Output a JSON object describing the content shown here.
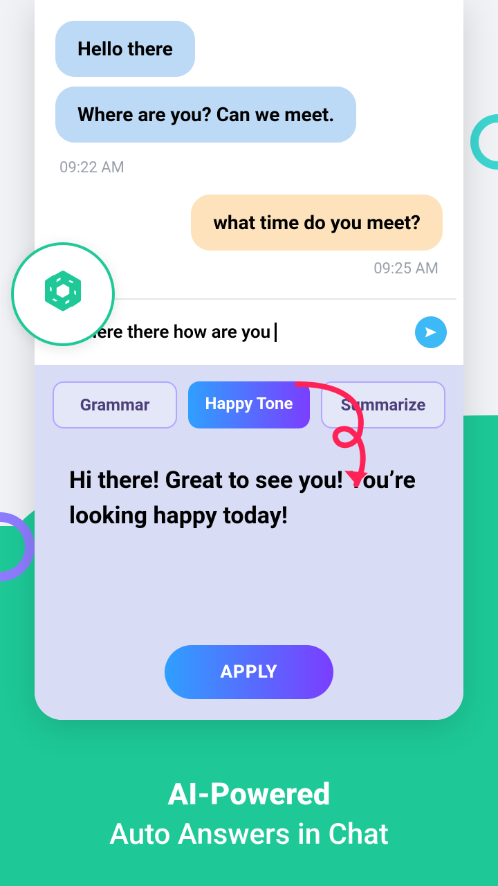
{
  "chat": {
    "messages": [
      {
        "text": "Hello there",
        "side": "left"
      },
      {
        "text": "Where are you? Can we meet.",
        "side": "left"
      }
    ],
    "time_left": "09:22 AM",
    "reply": {
      "text": "what time do you meet?"
    },
    "time_right": "09:25 AM"
  },
  "input": {
    "text": "Here there how are you"
  },
  "panel": {
    "pills": [
      {
        "label": "Grammar",
        "active": false
      },
      {
        "label": "Happy Tone",
        "active": true
      },
      {
        "label": "Summarize",
        "active": false
      }
    ],
    "suggestion": "Hi there! Great to see you! You’re looking happy today!",
    "apply_label": "APPLY"
  },
  "footer": {
    "line1": "AI-Powered",
    "line2": "Auto Answers in Chat"
  }
}
